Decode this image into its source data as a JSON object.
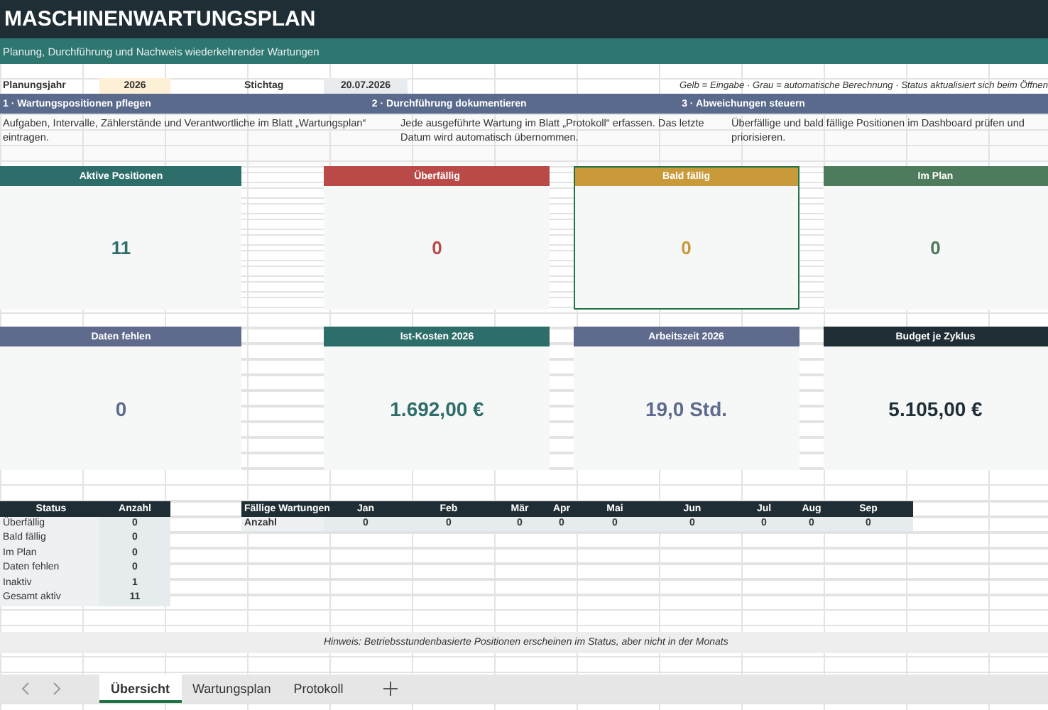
{
  "title": "MASCHINENWARTUNGSPLAN",
  "subtitle": "Planung, Durchführung und Nachweis wiederkehrender Wartungen",
  "inputs": [
    {
      "label": "Planungsjahr",
      "value": "2026",
      "kind": "input"
    },
    {
      "label": "Stichtag",
      "value": "20.07.2026",
      "kind": "calc"
    }
  ],
  "legend": "Gelb = Eingabe · Grau = automatische Berechnung · Status aktualisiert sich beim Öffnen",
  "steps": [
    {
      "title": "1 · Wartungspositionen pflegen",
      "text": "Aufgaben, Intervalle, Zählerstände und Verantwortliche im Blatt „Wartungsplan“ eintragen."
    },
    {
      "title": "2 · Durchführung dokumentieren",
      "text": "Jede ausgeführte Wartung im Blatt „Protokoll“ erfassen. Das letzte Datum wird automatisch übernommen."
    },
    {
      "title": "3 · Abweichungen steuern",
      "text": "Überfällige und bald fällige Positionen im Dashboard prüfen und priorisieren."
    }
  ],
  "cards": [
    {
      "label": "Aktive Positionen",
      "value": "11",
      "color": "#2e6e6a",
      "selected": false
    },
    {
      "label": "Überfällig",
      "value": "0",
      "color": "#b94a48",
      "selected": false
    },
    {
      "label": "Bald fällig",
      "value": "0",
      "color": "#c99a3a",
      "selected": true
    },
    {
      "label": "Im Plan",
      "value": "0",
      "color": "#4e7b5c",
      "selected": false
    },
    {
      "label": "Daten fehlen",
      "value": "0",
      "color": "#5f6b8c",
      "selected": false
    },
    {
      "label": "Ist-Kosten 2026",
      "value": "1.692,00 €",
      "color": "#2e6e6a",
      "selected": false
    },
    {
      "label": "Arbeitszeit 2026",
      "value": "19,0 Std.",
      "color": "#5f6b8c",
      "selected": false
    },
    {
      "label": "Budget je Zyklus",
      "value": "5.105,00 €",
      "color": "#1f2d35",
      "selected": false
    }
  ],
  "status_table": {
    "columns": [
      "Status",
      "Anzahl"
    ],
    "rows": [
      {
        "label": "Überfällig",
        "value": "0"
      },
      {
        "label": "Bald fällig",
        "value": "0"
      },
      {
        "label": "Im Plan",
        "value": "0"
      },
      {
        "label": "Daten fehlen",
        "value": "0"
      },
      {
        "label": "Inaktiv",
        "value": "1"
      },
      {
        "label": "Gesamt aktiv",
        "value": "11"
      }
    ]
  },
  "due_table": {
    "columns": [
      "Fällige Wartungen",
      "Jan",
      "Feb",
      "Mär",
      "Apr",
      "Mai",
      "Jun",
      "Jul",
      "Aug",
      "Sep"
    ],
    "rows": [
      {
        "label": "Anzahl",
        "values": [
          "0",
          "0",
          "0",
          "0",
          "0",
          "0",
          "0",
          "0",
          "0"
        ]
      }
    ]
  },
  "note": "Hinweis: Betriebsstundenbasierte Positionen erscheinen im Status, aber nicht in der Monats",
  "sheet_tabs": [
    {
      "label": "Übersicht",
      "selected": true
    },
    {
      "label": "Wartungsplan",
      "selected": false
    },
    {
      "label": "Protokoll",
      "selected": false
    }
  ]
}
